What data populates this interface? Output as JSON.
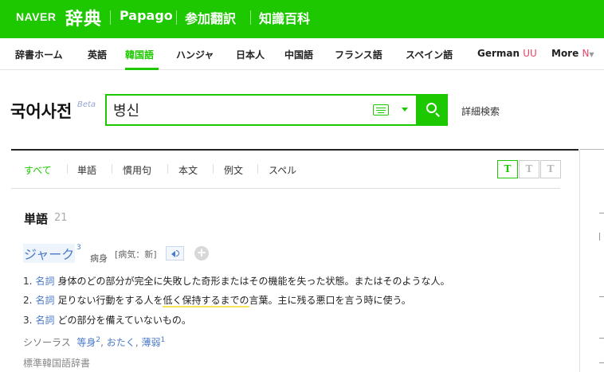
{
  "header": {
    "naver_logo": "NAVER",
    "dict_logo": "辞典",
    "links": [
      "Papago",
      "参加翻訳",
      "知識百科"
    ]
  },
  "lang_nav": {
    "items": [
      "辞書ホーム",
      "英語",
      "韓国語",
      "ハンジャ",
      "日本人",
      "中国語",
      "フランス語",
      "スペイン語"
    ],
    "active": "韓国語",
    "german_label": "German",
    "german_badge": "UU",
    "more_label": "More",
    "more_badge": "N"
  },
  "search": {
    "logo": "국어사전",
    "beta": "Beta",
    "query": "병신",
    "advanced_label": "詳細検索"
  },
  "filter_tabs": {
    "items": [
      "すべて",
      "単語",
      "慣用句",
      "本文",
      "例文",
      "スペル"
    ],
    "active": "すべて"
  },
  "text_size": [
    "T",
    "T",
    "T"
  ],
  "results": {
    "section_title": "単語",
    "section_count": "21",
    "entry": {
      "word": "ジャーク",
      "sup": "3",
      "hanja": "病身",
      "pronunciation": "[病気：新]"
    },
    "definitions": [
      {
        "num": "1.",
        "pos": "名詞",
        "text": "身体のどの部分が完全に失敗した奇形またはその機能を失った状態。またはそのような人。"
      },
      {
        "num": "2.",
        "pos": "名詞",
        "text_before": "足りない行動をする人を",
        "text_highlight": "低く保持するまでの",
        "text_after": "言葉。主に残る悪口を言う時に使う。"
      },
      {
        "num": "3.",
        "pos": "名詞",
        "text": "どの部分を備えていないもの。"
      }
    ],
    "thesaurus": {
      "label": "シソーラス",
      "syn1": "等身",
      "syn1_sup": "2",
      "syn2": "おたく",
      "syn3": "薄弱",
      "syn3_sup": "1"
    },
    "source": "標準韓国語辞書"
  },
  "colors": {
    "brand_green": "#1ec800",
    "link_blue": "#4a79c7",
    "badge_red": "#e94362"
  }
}
